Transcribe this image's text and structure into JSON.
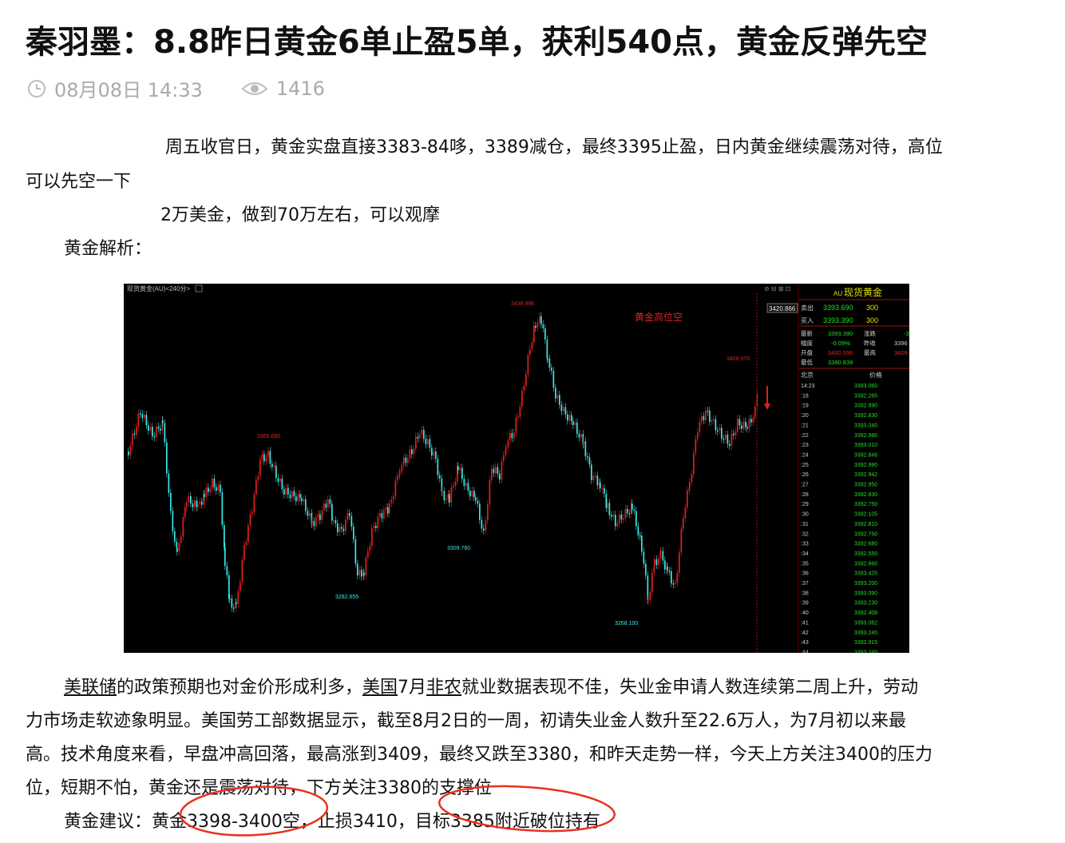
{
  "article": {
    "title": "秦羽墨：8.8昨日黄金6单止盈5单，获利540点，黄金反弹先空",
    "date": "08月08日 14:33",
    "views": "1416"
  },
  "paragraphs": {
    "p1_line1": "周五收官日，黄金实盘直接3383-84哆，3389减仓，最终3395止盈，日内黄金继续震荡对待，高位",
    "p1_line2": "可以先空一下",
    "p2": "2万美金，做到70万左右，可以观摩",
    "p3": "黄金解析：",
    "p4_link1": "美联储",
    "p4_text1": "的政策预期也对金价形成利多，",
    "p4_link2": "美国",
    "p4_text2": "7月",
    "p4_link3": "非农",
    "p4_text3": "就业数据表现不佳，失业金申请人数连续第二周上升，劳动",
    "p4_line2": "力市场走软迹象明显。美国劳工部数据显示，截至8月2日的一周，初请失业金人数升至22.6万人，为7月初以来最",
    "p4_line3": "高。技术角度来看，早盘冲高回落，最高涨到3409，最终又跌至3380，和昨天走势一样，今天上方关注3400的压力",
    "p4_line4": "位，短期不怕，黄金还是震荡对待，下方关注3380的支撑位",
    "p5": "黄金建议：黄金3398-3400空，止损3410，目标3385附近破位持有"
  },
  "chart_panel": {
    "header": "现货黄金(AU)<240分>",
    "annotation": "黄金高位空",
    "price_tag": "3420.866",
    "labels": [
      "3438.896",
      "3408.970",
      "3365.680",
      "3309.760",
      "3282.655",
      "3268.100"
    ],
    "quote_title_prefix": "AU",
    "quote_title": "现货黄金",
    "sell_label": "卖出",
    "sell_price": "3393.690",
    "sell_vol": "300",
    "buy_label": "买入",
    "buy_price": "3393.390",
    "buy_vol": "300",
    "latest_label": "最新",
    "latest": "3393.390",
    "change_label": "涨跌",
    "change": "-3",
    "range_label": "幅度",
    "range": "-0.09%",
    "prev_label": "昨收",
    "prev": "3396",
    "open_label": "开盘",
    "open": "3400.056",
    "high_label": "最高",
    "high": "3409",
    "low_label": "最低",
    "low": "3380.839",
    "col_time": "北京",
    "col_price": "价格",
    "ticks": [
      [
        "14:23",
        "3393.060"
      ],
      [
        ":18",
        "3392.265"
      ],
      [
        ":19",
        "3392.990"
      ],
      [
        ":20",
        "3392.830"
      ],
      [
        ":21",
        "3393.040"
      ],
      [
        ":22",
        "3392.980"
      ],
      [
        ":23",
        "3393.010"
      ],
      [
        ":24",
        "3392.846"
      ],
      [
        ":25",
        "3392.990"
      ],
      [
        ":26",
        "3392.942"
      ],
      [
        ":27",
        "3392.950"
      ],
      [
        ":28",
        "3392.830"
      ],
      [
        ":29",
        "3392.750"
      ],
      [
        ":30",
        "3392.105"
      ],
      [
        ":31",
        "3392.810"
      ],
      [
        ":32",
        "3392.750"
      ],
      [
        ":33",
        "3392.680"
      ],
      [
        ":34",
        "3392.550"
      ],
      [
        ":35",
        "3392.660"
      ],
      [
        ":36",
        "3393.420"
      ],
      [
        ":37",
        "3393.200"
      ],
      [
        ":38",
        "3393.090"
      ],
      [
        ":39",
        "3393.230"
      ],
      [
        ":40",
        "3392.408"
      ],
      [
        ":41",
        "3393.062"
      ],
      [
        ":42",
        "3393.240"
      ],
      [
        ":43",
        "3392.915"
      ],
      [
        ":44",
        "3393.240"
      ]
    ]
  },
  "colors": {
    "up": "#e02020",
    "down": "#39e8e8",
    "quote_green": "#20e020",
    "quote_yellow": "#f0e000",
    "circle": "#e8321e"
  }
}
